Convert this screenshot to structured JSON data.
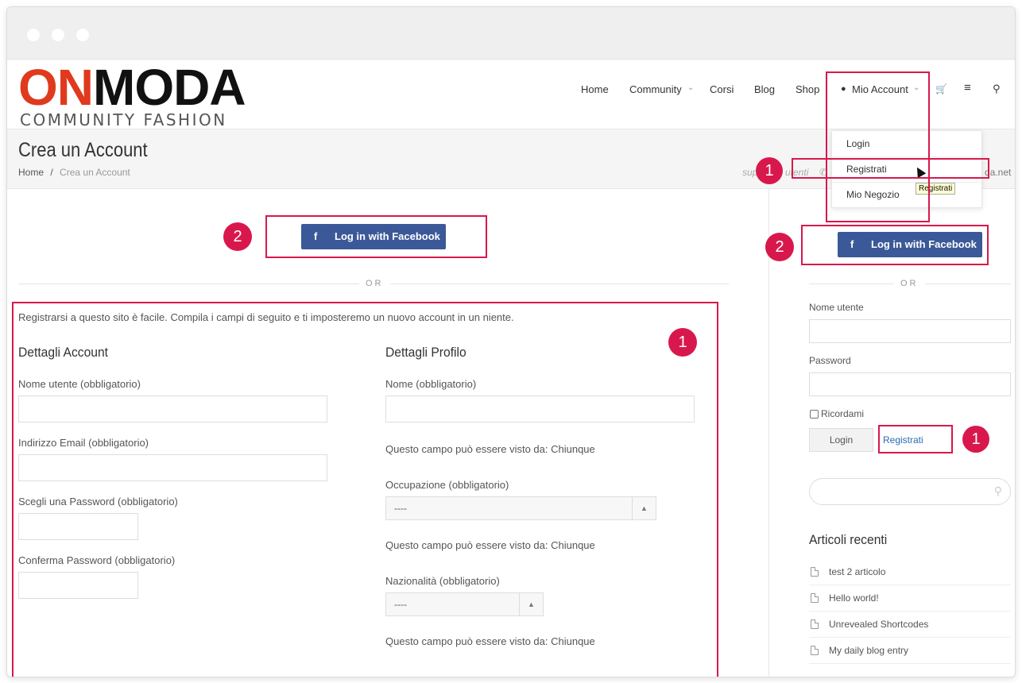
{
  "header": {
    "logo_main_red": "ON",
    "logo_main_black": "MODA",
    "logo_sub": "COMMUNITY FASHION",
    "nav": [
      "Home",
      "Community",
      "Corsi",
      "Blog",
      "Shop",
      "Mio Account"
    ]
  },
  "dropdown": {
    "items": [
      "Login",
      "Registrati",
      "Mio Negozio"
    ],
    "tooltip": "Registrati"
  },
  "title_bar": {
    "title": "Crea un Account",
    "breadcrumb": [
      "Home",
      "Crea un Account"
    ],
    "breadcrumb_sep": "/",
    "support_fragment": "sup",
    "support_utenti": "utenti",
    "support_tail": "da.net"
  },
  "facebook": {
    "label": "Log in with Facebook",
    "icon": "f"
  },
  "separator": "OR",
  "intro": "Registrarsi a questo sito è facile. Compila i campi di seguito e ti imposteremo un nuovo account in un niente.",
  "account": {
    "heading": "Dettagli Account",
    "username_label": "Nome utente (obbligatorio)",
    "email_label": "Indirizzo Email (obbligatorio)",
    "password_label": "Scegli una Password (obbligatorio)",
    "confirm_label": "Conferma Password (obbligatorio)"
  },
  "profile": {
    "heading": "Dettagli Profilo",
    "name_label": "Nome (obbligatorio)",
    "visibility_note": "Questo campo può essere visto da: Chiunque",
    "occupation_label": "Occupazione (obbligatorio)",
    "select_default": "----",
    "nationality_label": "Nazionalità (obbligatorio)"
  },
  "sidebar": {
    "username_label": "Nome utente",
    "password_label": "Password",
    "remember_label": "Ricordami",
    "login_button": "Login",
    "register_link": "Registrati",
    "recent_title": "Articoli recenti",
    "articles": [
      "test 2 articolo",
      "Hello world!",
      "Unrevealed Shortcodes",
      "My daily blog entry"
    ]
  },
  "annotations": {
    "badge_one": "1",
    "badge_two": "2"
  },
  "colors": {
    "facebook_blue": "#3b5998",
    "annotation_red": "#d8184c",
    "logo_red": "#e03a1e",
    "link_blue": "#2a6db0"
  }
}
